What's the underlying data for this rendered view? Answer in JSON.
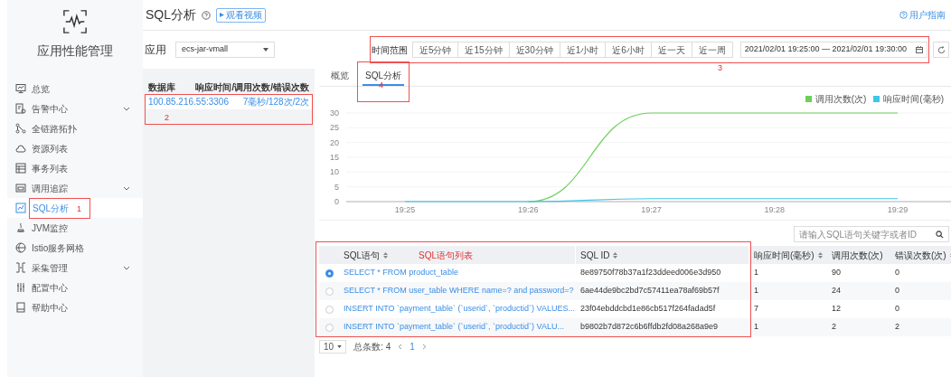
{
  "sidebar": {
    "title": "应用性能管理",
    "items": [
      {
        "label": "总览",
        "expandable": false,
        "selected": false
      },
      {
        "label": "告警中心",
        "expandable": true,
        "selected": false
      },
      {
        "label": "全链路拓扑",
        "expandable": false,
        "selected": false
      },
      {
        "label": "资源列表",
        "expandable": false,
        "selected": false
      },
      {
        "label": "事务列表",
        "expandable": false,
        "selected": false
      },
      {
        "label": "调用追踪",
        "expandable": true,
        "selected": false
      },
      {
        "label": "SQL分析",
        "expandable": false,
        "selected": true,
        "annotation": "1"
      },
      {
        "label": "JVM监控",
        "expandable": false,
        "selected": false
      },
      {
        "label": "Istio服务网格",
        "expandable": false,
        "selected": false
      },
      {
        "label": "采集管理",
        "expandable": true,
        "selected": false
      },
      {
        "label": "配置中心",
        "expandable": false,
        "selected": false
      },
      {
        "label": "帮助中心",
        "expandable": false,
        "selected": false
      }
    ]
  },
  "header": {
    "title": "SQL分析",
    "video_button": "观看视频",
    "guide_link": "用户指南"
  },
  "app_selector": {
    "label": "应用",
    "value": "ecs-jar-vmall"
  },
  "time_range": {
    "label": "时间范围",
    "annotation": "3",
    "options": [
      {
        "label": "近5分钟",
        "selected": false
      },
      {
        "label": "近15分钟",
        "selected": false
      },
      {
        "label": "近30分钟",
        "selected": false
      },
      {
        "label": "近1小时",
        "selected": false
      },
      {
        "label": "近6小时",
        "selected": false
      },
      {
        "label": "近一天",
        "selected": false
      },
      {
        "label": "近一周",
        "selected": false
      }
    ],
    "custom": "2021/02/01 19:25:00 — 2021/02/01 19:30:00"
  },
  "db_panel": {
    "columns": [
      "数据库",
      "响应时间/调用次数/错误次数"
    ],
    "annotation": "2",
    "rows": [
      {
        "database": "100.85.216.55:3306",
        "stats": "7毫秒/128次/2次",
        "selected": true
      }
    ]
  },
  "tabs": {
    "annotation": "4",
    "items": [
      {
        "label": "概览",
        "selected": false
      },
      {
        "label": "SQL分析",
        "selected": true
      }
    ]
  },
  "chart": {
    "chart_data": {
      "type": "line",
      "legend": "top-right",
      "grid": true,
      "categories": [
        "19:25",
        "19:26",
        "19:27",
        "19:28",
        "19:29"
      ],
      "ylim": [
        0,
        30
      ],
      "yticks": [
        0,
        5,
        10,
        15,
        20,
        25,
        30
      ],
      "series": [
        {
          "name": "调用次数(次)",
          "color": "#6ccf5a",
          "values": [
            null,
            0,
            30,
            30,
            30
          ]
        },
        {
          "name": "响应时间(毫秒)",
          "color": "#3ec6ea",
          "values": [
            0,
            0,
            1,
            1,
            1
          ]
        }
      ]
    }
  },
  "search": {
    "placeholder": "请输入SQL语句关键字或者ID"
  },
  "table": {
    "annotation": "SQL语句列表",
    "columns": [
      "SQL语句",
      "SQL ID",
      "响应时间(毫秒)",
      "调用次数(次)",
      "错误次数(次)"
    ],
    "rows": [
      {
        "selected": true,
        "sql": "SELECT * FROM product_table",
        "id": "8e89750f78b37a1f23ddeed006e3d950",
        "time": "1",
        "calls": "90",
        "errors": "0"
      },
      {
        "selected": false,
        "sql": "SELECT * FROM user_table WHERE name=? and password=?",
        "id": "6ae44de9bc2bd7c57411ea78af69b57f",
        "time": "1",
        "calls": "24",
        "errors": "0"
      },
      {
        "selected": false,
        "sql": "INSERT INTO `payment_table` (`userid`, `productid`) VALUES...",
        "id": "23f04ebddcbd1e86cb517f264fadad5f",
        "time": "7",
        "calls": "12",
        "errors": "0"
      },
      {
        "selected": false,
        "sql": "INSERT INTO `payment_table`  (`userid`, `productid`)  VALU...",
        "id": "b9802b7d872c6b6ffdb2fd08a268a9e9",
        "time": "1",
        "calls": "2",
        "errors": "2"
      }
    ]
  },
  "pagination": {
    "page_size": "10",
    "total": "总条数: 4",
    "current_page": "1"
  }
}
